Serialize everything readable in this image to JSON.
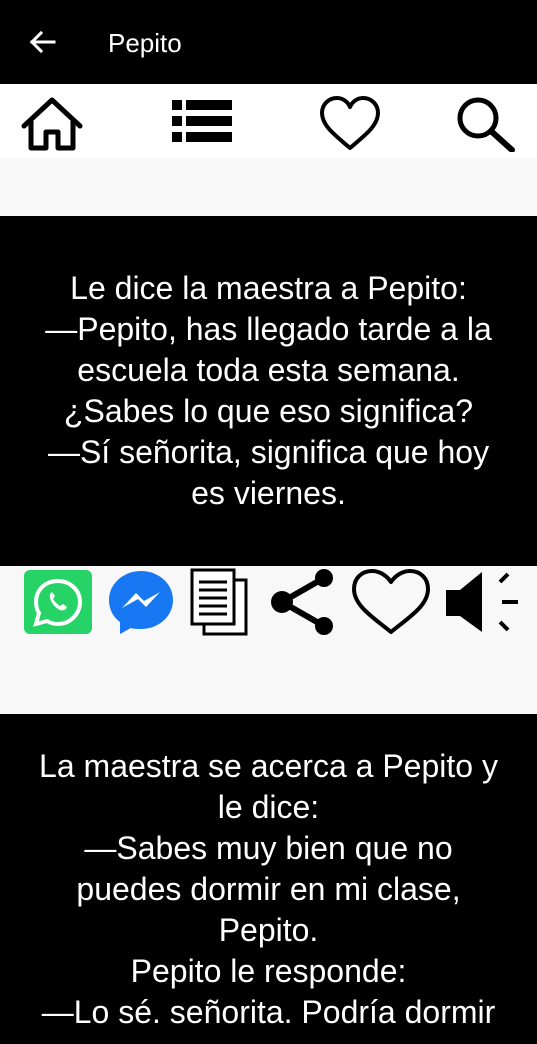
{
  "appbar": {
    "title": "Pepito",
    "back_icon": "arrow-left-icon"
  },
  "toolbar": {
    "icons": [
      "home-icon",
      "list-icon",
      "heart-outline-icon",
      "search-icon"
    ]
  },
  "jokes": [
    {
      "text": "Le dice la maestra a Pepito:\n—Pepito, has llegado tarde a la\nescuela toda esta semana.\n¿Sabes lo que eso significa?\n—Sí señorita, significa que hoy\nes viernes."
    },
    {
      "text": "La maestra se acerca a Pepito y\nle dice:\n—Sabes muy bien que no\npuedes dormir en mi clase,\nPepito.\nPepito le responde:\n—Lo sé. señorita. Podría dormir"
    }
  ],
  "actions": [
    "whatsapp-icon",
    "messenger-icon",
    "copy-icon",
    "share-icon",
    "favorite-icon",
    "speaker-icon"
  ],
  "colors": {
    "whatsapp": "#25D366",
    "messenger": "#1877F2",
    "bar": "#000000",
    "toolbar": "#FFFFFF",
    "gap": "#F8F8F8"
  }
}
